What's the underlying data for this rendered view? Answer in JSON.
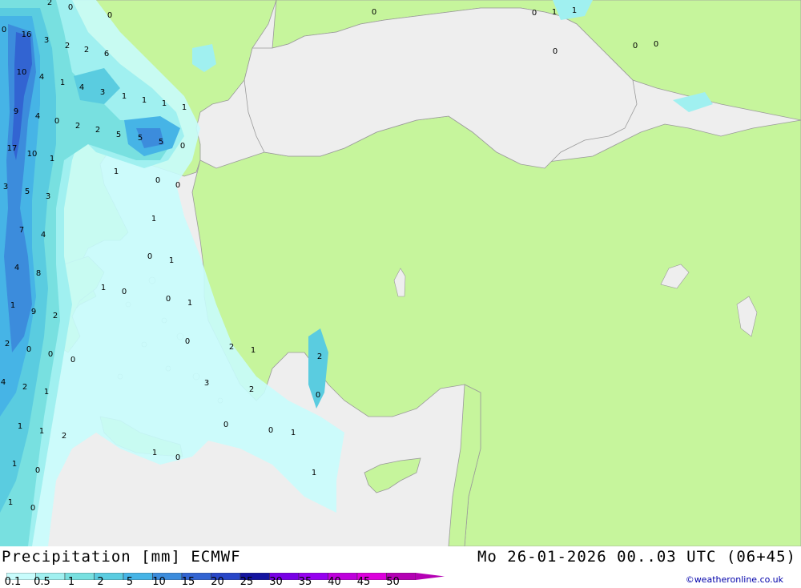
{
  "title": "Precipitation [mm] ECMWF",
  "datetime": "Mo 26-01-2026 00..03 UTC (06+45)",
  "credit": "©weatheronline.co.uk",
  "colors": {
    "land": "#c6f59c",
    "sea": "#eeeeee",
    "border": "#9a9a9a"
  },
  "legend": {
    "labels": [
      "0.1",
      "0.5",
      "1",
      "2",
      "5",
      "10",
      "15",
      "20",
      "25",
      "30",
      "35",
      "40",
      "45",
      "50"
    ],
    "colors": [
      "#c8fcfc",
      "#a0f0f0",
      "#78e0e0",
      "#5acce0",
      "#46b4e6",
      "#3c8cdc",
      "#3264d2",
      "#2846c8",
      "#1414a0",
      "#7800e6",
      "#9600f0",
      "#be00dc",
      "#dc00dc",
      "#b400b4"
    ]
  },
  "map_values": [
    "2",
    "0",
    "0",
    "0",
    "16",
    "3",
    "2",
    "2",
    "6",
    "10",
    "4",
    "1",
    "4",
    "3",
    "1",
    "1",
    "1",
    "1",
    "9",
    "4",
    "0",
    "2",
    "2",
    "5",
    "5",
    "5",
    "0",
    "17",
    "10",
    "1",
    "1",
    "0",
    "0",
    "3",
    "5",
    "3",
    "1",
    "7",
    "4",
    "0",
    "1",
    "4",
    "8",
    "1",
    "0",
    "0",
    "1",
    "1",
    "9",
    "2",
    "0",
    "2",
    "1",
    "2",
    "0",
    "0",
    "2",
    "0",
    "4",
    "2",
    "1",
    "3",
    "2",
    "0",
    "1",
    "1",
    "0",
    "0",
    "1",
    "2",
    "1",
    "0",
    "1",
    "0",
    "1",
    "1",
    "0",
    "0",
    "0",
    "1",
    "1",
    "0",
    "0",
    "0"
  ]
}
